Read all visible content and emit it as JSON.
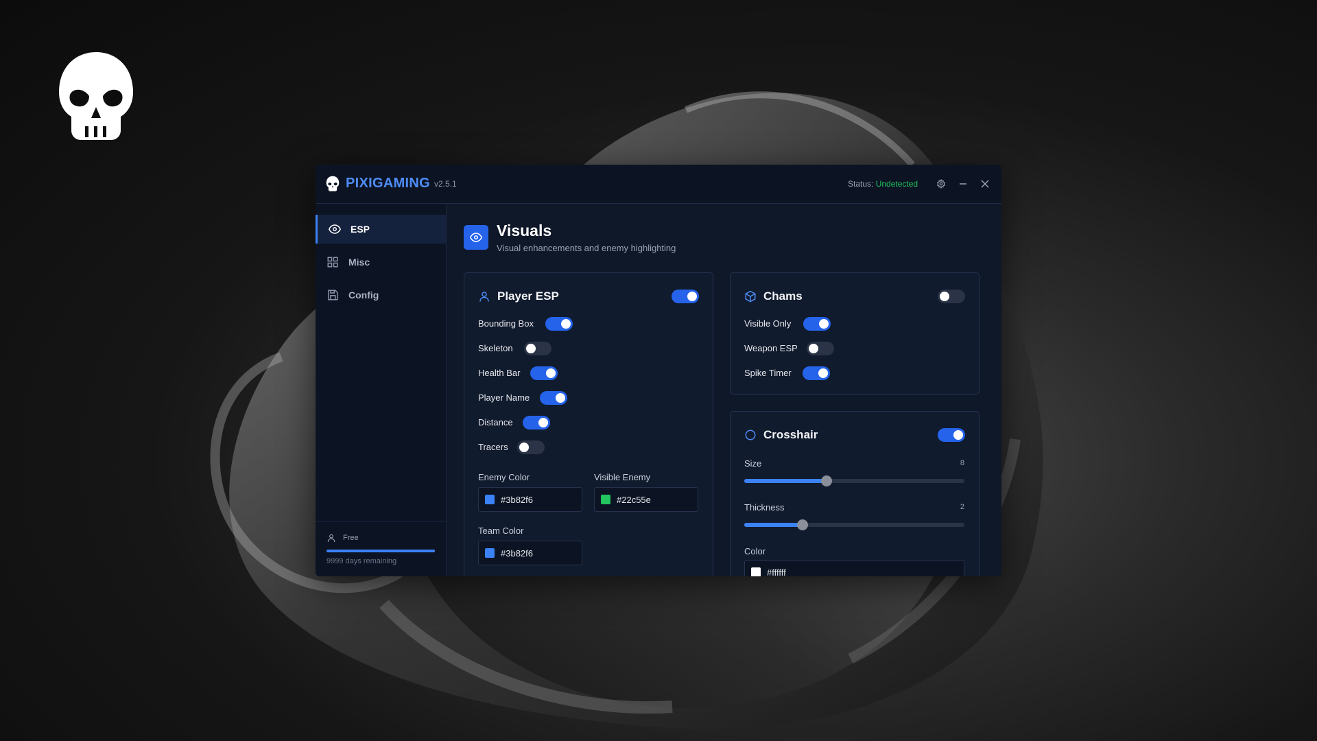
{
  "app": {
    "brand": "PIXIGAMING",
    "version": "v2.5.1"
  },
  "status": {
    "label": "Status:",
    "value": "Undetected"
  },
  "sidebar": {
    "items": [
      {
        "label": "ESP",
        "icon": "eye-icon",
        "active": true
      },
      {
        "label": "Misc",
        "icon": "grid-icon",
        "active": false
      },
      {
        "label": "Config",
        "icon": "save-icon",
        "active": false
      }
    ],
    "plan": {
      "label": "Free",
      "days": "9999 days remaining",
      "progress": 1.0
    }
  },
  "page": {
    "title": "Visuals",
    "subtitle": "Visual enhancements and enemy highlighting"
  },
  "player_esp": {
    "title": "Player ESP",
    "enabled": true,
    "options": [
      {
        "label": "Bounding Box",
        "on": true
      },
      {
        "label": "Skeleton",
        "on": false
      },
      {
        "label": "Health Bar",
        "on": true
      },
      {
        "label": "Player Name",
        "on": true
      },
      {
        "label": "Distance",
        "on": true
      },
      {
        "label": "Tracers",
        "on": false
      }
    ],
    "colors": [
      {
        "label": "Enemy Color",
        "value": "#3b82f6"
      },
      {
        "label": "Visible Enemy",
        "value": "#22c55e"
      },
      {
        "label": "Team Color",
        "value": "#3b82f6"
      }
    ]
  },
  "chams": {
    "title": "Chams",
    "enabled": false,
    "options": [
      {
        "label": "Visible Only",
        "on": true
      },
      {
        "label": "Weapon ESP",
        "on": false
      },
      {
        "label": "Spike Timer",
        "on": true
      }
    ]
  },
  "crosshair": {
    "title": "Crosshair",
    "enabled": true,
    "size": {
      "label": "Size",
      "value": "8",
      "fraction": 0.375
    },
    "thickness": {
      "label": "Thickness",
      "value": "2",
      "fraction": 0.265
    },
    "color": {
      "label": "Color",
      "value": "#ffffff"
    }
  }
}
